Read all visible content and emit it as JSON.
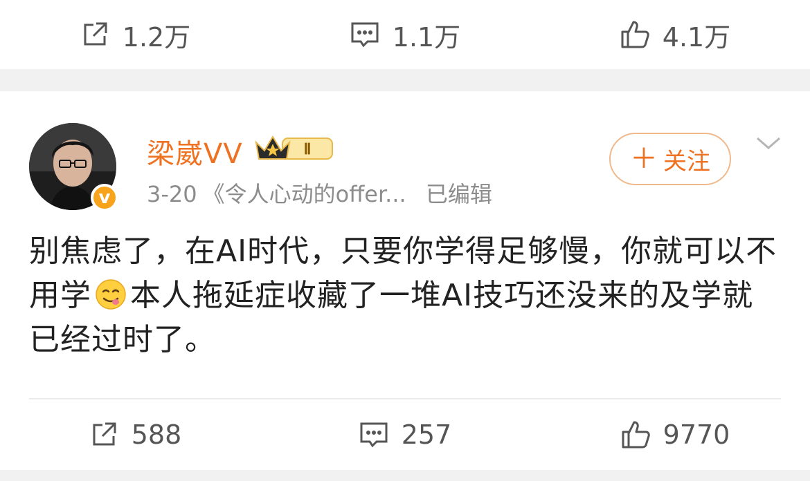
{
  "top_actions": {
    "repost": {
      "count": "1.2万",
      "icon": "repost-icon"
    },
    "comment": {
      "count": "1.1万",
      "icon": "comment-icon"
    },
    "like": {
      "count": "4.1万",
      "icon": "like-icon"
    }
  },
  "post": {
    "author": {
      "name": "梁崴VV",
      "badge_level": "Ⅱ",
      "verified_mark": "v"
    },
    "meta": {
      "date": "3-20",
      "source": "《令人心动的offer...",
      "edited": "已编辑"
    },
    "follow_label": "关注",
    "content": {
      "part1": "别焦虑了，在AI时代，只要你学得足够慢，你就可以不用学",
      "emoji": "yum-face-emoji",
      "part2": "本人拖延症收藏了一堆AI技巧还没来的及学就已经过时了。"
    },
    "actions": {
      "repost": {
        "count": "588",
        "icon": "repost-icon"
      },
      "comment": {
        "count": "257",
        "icon": "comment-icon"
      },
      "like": {
        "count": "9770",
        "icon": "like-icon"
      }
    }
  },
  "colors": {
    "accent": "#ef7222",
    "muted": "#8c8c8c",
    "background": "#f1f1f1"
  }
}
